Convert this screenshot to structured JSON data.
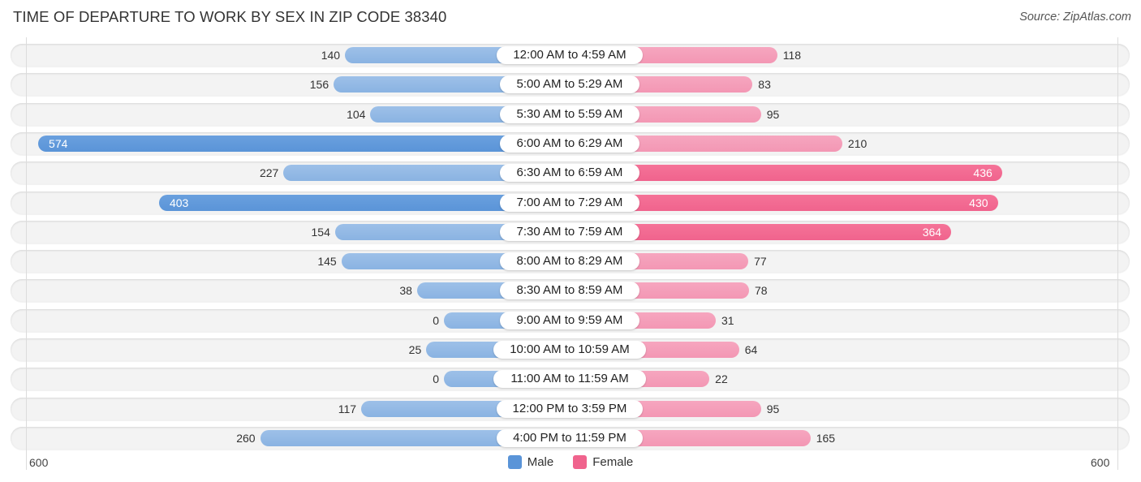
{
  "title": "TIME OF DEPARTURE TO WORK BY SEX IN ZIP CODE 38340",
  "source": "Source: ZipAtlas.com",
  "colors": {
    "male": "#8ab3e2",
    "male_strong": "#5a94d8",
    "female": "#f397b4",
    "female_strong": "#f0638d"
  },
  "chart_data": {
    "type": "bar",
    "orientation": "horizontal-diverging",
    "title": "TIME OF DEPARTURE TO WORK BY SEX IN ZIP CODE 38340",
    "categories": [
      "12:00 AM to 4:59 AM",
      "5:00 AM to 5:29 AM",
      "5:30 AM to 5:59 AM",
      "6:00 AM to 6:29 AM",
      "6:30 AM to 6:59 AM",
      "7:00 AM to 7:29 AM",
      "7:30 AM to 7:59 AM",
      "8:00 AM to 8:29 AM",
      "8:30 AM to 8:59 AM",
      "9:00 AM to 9:59 AM",
      "10:00 AM to 10:59 AM",
      "11:00 AM to 11:59 AM",
      "12:00 PM to 3:59 PM",
      "4:00 PM to 11:59 PM"
    ],
    "series": [
      {
        "name": "Male",
        "values": [
          140,
          156,
          104,
          574,
          227,
          403,
          154,
          145,
          38,
          0,
          25,
          0,
          117,
          260
        ]
      },
      {
        "name": "Female",
        "values": [
          118,
          83,
          95,
          210,
          436,
          430,
          364,
          77,
          78,
          31,
          64,
          22,
          95,
          165
        ]
      }
    ],
    "xlim": [
      600,
      600
    ],
    "axis_ticks": {
      "left": "600",
      "right": "600"
    },
    "legend": {
      "position": "bottom-center",
      "entries": [
        "Male",
        "Female"
      ]
    },
    "grid": false
  }
}
